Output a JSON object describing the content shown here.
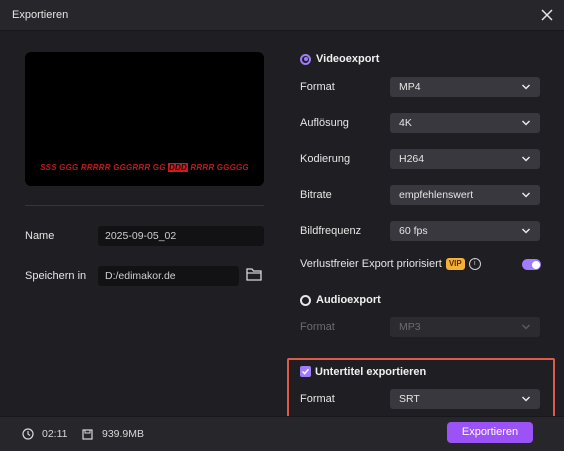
{
  "window": {
    "title": "Exportieren"
  },
  "preview": {
    "subtitle_pre": "SSS GGG RRRRR GGGRRR GG ",
    "subtitle_highlight": "DDD",
    "subtitle_post": " RRRR GGGGG"
  },
  "left": {
    "name_label": "Name",
    "name_value": "2025-09-05_02",
    "save_label": "Speichern in",
    "save_value": "D:/edimakor.de"
  },
  "video": {
    "header": "Videoexport",
    "rows": [
      {
        "label": "Format",
        "value": "MP4"
      },
      {
        "label": "Auflösung",
        "value": "4K"
      },
      {
        "label": "Kodierung",
        "value": "H264"
      },
      {
        "label": "Bitrate",
        "value": "empfehlenswert"
      },
      {
        "label": "Bildfrequenz",
        "value": "60  fps"
      }
    ],
    "lossless_label": "Verlustfreier Export priorisiert",
    "vip_badge": "VIP",
    "info_glyph": "i"
  },
  "audio": {
    "header": "Audioexport",
    "format_label": "Format",
    "format_value": "MP3"
  },
  "subtitles": {
    "header": "Untertitel exportieren",
    "format_label": "Format",
    "format_value": "SRT"
  },
  "footer": {
    "duration": "02:11",
    "size": "939.9MB",
    "export_button": "Exportieren"
  },
  "colors": {
    "accent": "#9b52f7",
    "highlight_border": "#e05a4a",
    "vip": "#f4b13a"
  }
}
